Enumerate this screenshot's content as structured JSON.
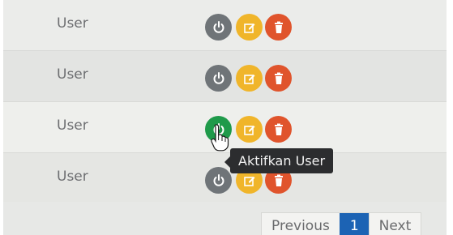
{
  "rows": [
    {
      "role": "User",
      "power_state": "inactive"
    },
    {
      "role": "User",
      "power_state": "inactive"
    },
    {
      "role": "User",
      "power_state": "active"
    },
    {
      "role": "User",
      "power_state": "inactive"
    }
  ],
  "icons": {
    "power": "power-icon",
    "edit": "edit-icon",
    "delete": "trash-icon"
  },
  "tooltip": {
    "text": "Aktifkan User"
  },
  "pagination": {
    "previous_label": "Previous",
    "current_page": "1",
    "next_label": "Next"
  },
  "colors": {
    "power_inactive": "#6f7478",
    "power_active": "#1f9a4a",
    "edit": "#f0b52a",
    "delete": "#e0542c",
    "tooltip_bg": "#2c2d2f",
    "page_active": "#1c63b4"
  }
}
